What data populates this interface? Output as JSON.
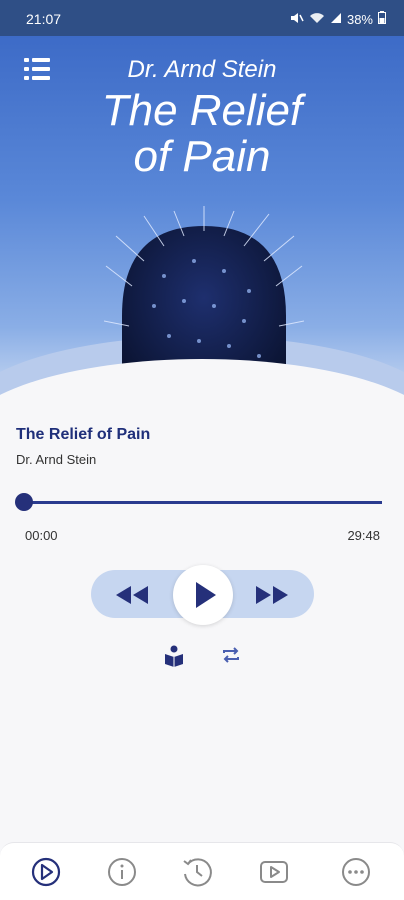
{
  "status_bar": {
    "time": "21:07",
    "battery": "38%",
    "icons": [
      "mute-icon",
      "wifi-icon",
      "signal-icon",
      "battery-icon"
    ]
  },
  "header": {
    "author": "Dr. Arnd Stein",
    "title_line1": "The Relief",
    "title_line2": "of Pain",
    "menu_icon": "list-menu-icon"
  },
  "track": {
    "title": "The Relief of Pain",
    "author": "Dr. Arnd Stein"
  },
  "player": {
    "current_time": "00:00",
    "total_time": "29:48",
    "progress_fraction": 0.0,
    "controls": [
      "rewind-icon",
      "play-icon",
      "fast-forward-icon"
    ],
    "extras": [
      "book-reader-icon",
      "repeat-icon"
    ]
  },
  "bottom_nav": {
    "items": [
      "player-icon",
      "info-icon",
      "history-icon",
      "video-icon",
      "more-icon"
    ],
    "active": "player-icon"
  },
  "colors": {
    "accent": "#25307a",
    "header_blue": "#3d6bc7",
    "control_pill": "#c6d6f0",
    "status_bar": "#2f4f86"
  }
}
